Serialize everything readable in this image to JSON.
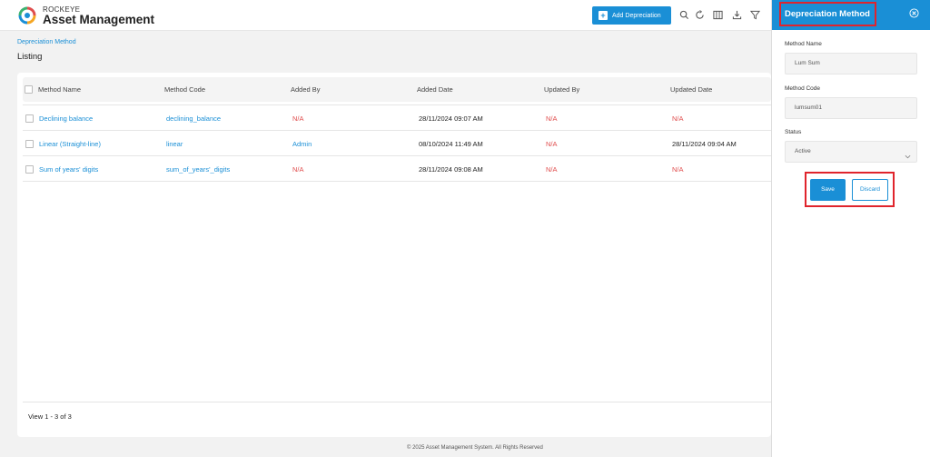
{
  "header": {
    "brand_top": "ROCKEYE",
    "brand_main": "Asset Management",
    "add_button": "Add Depreciation"
  },
  "breadcrumb": "Depreciation Method",
  "page_title": "Listing",
  "table": {
    "columns": [
      "Method Name",
      "Method Code",
      "Added By",
      "Added Date",
      "Updated By",
      "Updated Date"
    ],
    "rows": [
      {
        "name": "Declining balance",
        "code": "declining_balance",
        "added_by": "N/A",
        "added_date": "28/11/2024 09:07 AM",
        "updated_by": "N/A",
        "updated_date": "N/A"
      },
      {
        "name": "Linear (Straight-line)",
        "code": "linear",
        "added_by": "Admin",
        "added_date": "08/10/2024 11:49 AM",
        "updated_by": "N/A",
        "updated_date": "28/11/2024 09:04 AM"
      },
      {
        "name": "Sum of years' digits",
        "code": "sum_of_years'_digits",
        "added_by": "N/A",
        "added_date": "28/11/2024 09:08 AM",
        "updated_by": "N/A",
        "updated_date": "N/A"
      }
    ],
    "view_count": "View 1 - 3 of 3"
  },
  "copyright": "© 2025 Asset Management System. All Rights Reserved",
  "panel": {
    "title": "Depreciation Method",
    "method_name_label": "Method Name",
    "method_name_value": "Lum Sum",
    "method_code_label": "Method Code",
    "method_code_value": "lumsum01",
    "status_label": "Status",
    "status_value": "Active",
    "save_label": "Save",
    "discard_label": "Discard"
  },
  "colors": {
    "accent": "#1a8fd6",
    "na_red": "#e04e4e",
    "highlight": "#e0242c"
  },
  "icons": [
    "logo-icon",
    "plus-icon",
    "search-icon",
    "refresh-icon",
    "columns-icon",
    "download-icon",
    "filter-icon",
    "close-icon",
    "chevron-down-icon"
  ]
}
